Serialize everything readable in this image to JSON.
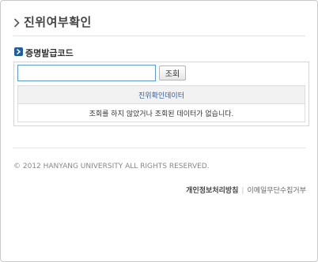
{
  "header": {
    "title": "진위여부확인"
  },
  "section": {
    "label": "증명발급코드"
  },
  "form": {
    "code_value": "",
    "search_label": "조회"
  },
  "table": {
    "header": "진위확인데이터",
    "message": "조회를 하지 않았거나 조회된 데이터가 없습니다."
  },
  "footer": {
    "copyright": "© 2012 HANYANG UNIVERSITY ALL RIGHTS RESERVED.",
    "privacy_link": "개인정보처리방침",
    "email_link": "이메일무단수집거부"
  },
  "colors": {
    "accent": "#1f5fa0",
    "input_border": "#5d9ad0",
    "link_blue": "#2b5c9e"
  },
  "icons": {
    "title": "chevron-right-icon",
    "section": "arrow-right-icon"
  }
}
